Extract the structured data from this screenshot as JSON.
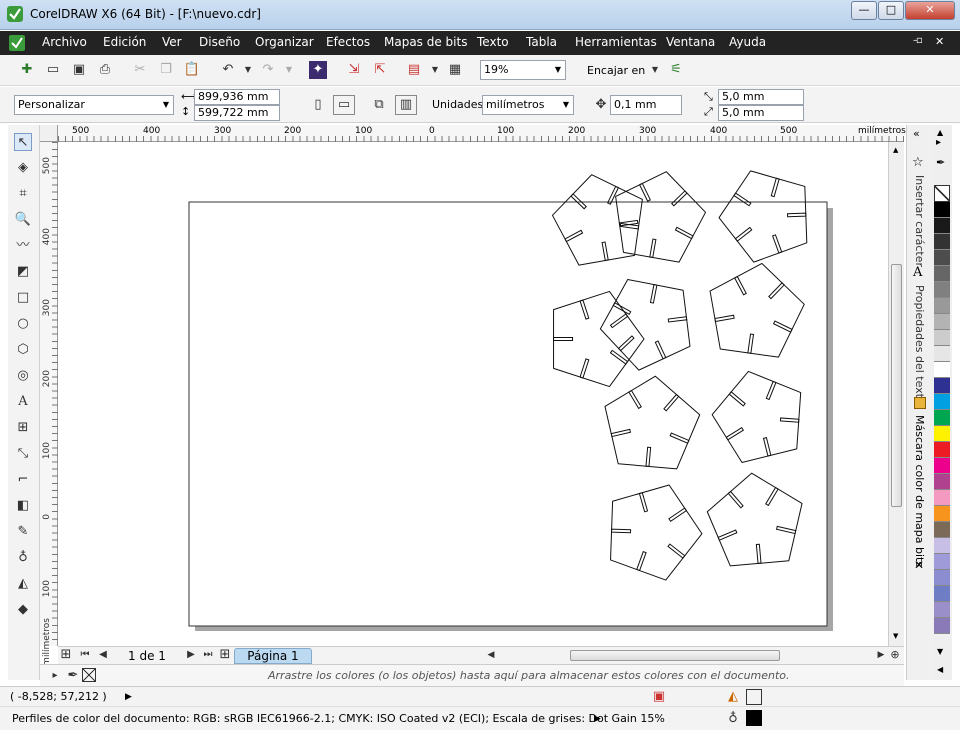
{
  "window": {
    "title": "CorelDRAW X6 (64 Bit) - [F:\\nuevo.cdr]"
  },
  "menu": [
    "Archivo",
    "Edición",
    "Ver",
    "Diseño",
    "Organizar",
    "Efectos",
    "Mapas de bits",
    "Texto",
    "Tabla",
    "Herramientas",
    "Ventana",
    "Ayuda"
  ],
  "toolbar": {
    "zoom": "19%",
    "snap": "Encajar en"
  },
  "propbar": {
    "preset": "Personalizar",
    "width": "899,936 mm",
    "height": "599,722 mm",
    "units_label": "Unidades:",
    "units": "milímetros",
    "nudge": "0,1 mm",
    "dup_x": "5,0 mm",
    "dup_y": "5,0 mm"
  },
  "ruler": {
    "h_labels": [
      "500",
      "400",
      "300",
      "200",
      "100",
      "0",
      "100",
      "200",
      "300",
      "400",
      "500"
    ],
    "h_unit": "milímetros",
    "v_labels": [
      "500",
      "400",
      "300",
      "200",
      "100",
      "0",
      "100"
    ],
    "v_unit": "milímetros"
  },
  "pages": {
    "count": "1 de 1",
    "tab": "Página 1"
  },
  "palette_hint": "Arrastre los colores (o los objetos) hasta aquí para almacenar estos colores con el documento.",
  "dockers": [
    "Insertar carácter",
    "Propiedades del texto",
    "Máscara color de mapa bits"
  ],
  "status": {
    "coords": "( -8,528; 57,212 )",
    "profiles": "Perfiles de color del documento: RGB: sRGB IEC61966-2.1; CMYK: ISO Coated v2 (ECI); Escala de grises: Dot Gain 15%"
  },
  "colors": {
    "menubar": "#232323",
    "palette": [
      "#000000",
      "#1a1a1a",
      "#333333",
      "#4d4d4d",
      "#666666",
      "#808080",
      "#999999",
      "#b3b3b3",
      "#cccccc",
      "#e6e6e6",
      "#ffffff",
      "#2e3192",
      "#00a0e3",
      "#00a650",
      "#fff200",
      "#ed1c24",
      "#ec008c",
      "#b0418f",
      "#f49ac1",
      "#f7941d",
      "#7c6a58",
      "#c8bfe7",
      "#9e9bd8",
      "#8c8cd0",
      "#6f7ec4",
      "#9b8fc9",
      "#8b7ab8"
    ]
  }
}
